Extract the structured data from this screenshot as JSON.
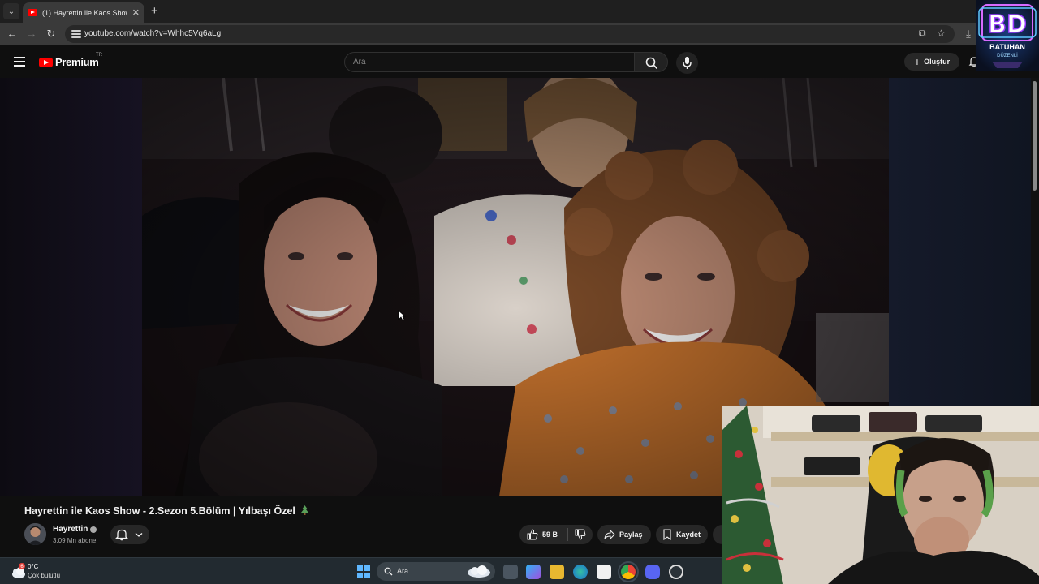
{
  "browser": {
    "tab_title": "(1) Hayrettin ile Kaos Show - 2.Sezon 5.Bölüm | Yılbaşı Özel",
    "url": "youtube.com/watch?v=Whhc5Vq6aLg"
  },
  "youtube": {
    "logo_text": "Premium",
    "country_code": "TR",
    "search_placeholder": "Ara",
    "create_label": "Oluştur"
  },
  "brand_overlay": {
    "initials": "BD",
    "name": "BATUHAN",
    "subname": "DÜZENLİ"
  },
  "video": {
    "title": "Hayrettin ile Kaos Show - 2.Sezon 5.Bölüm | Yılbaşı Özel",
    "channel_name": "Hayrettin",
    "subscribers": "3,09 Mn abone",
    "like_count": "59 B",
    "share_label": "Paylaş",
    "save_label": "Kaydet"
  },
  "taskbar": {
    "temperature": "0°C",
    "weather": "Çok bulutlu",
    "search_placeholder": "Ara",
    "weather_badge": "6"
  },
  "colors": {
    "youtube_red": "#ff0000",
    "page_bg": "#0f0f0f",
    "button_bg": "#272727",
    "taskbar_bg": "#222a30"
  }
}
